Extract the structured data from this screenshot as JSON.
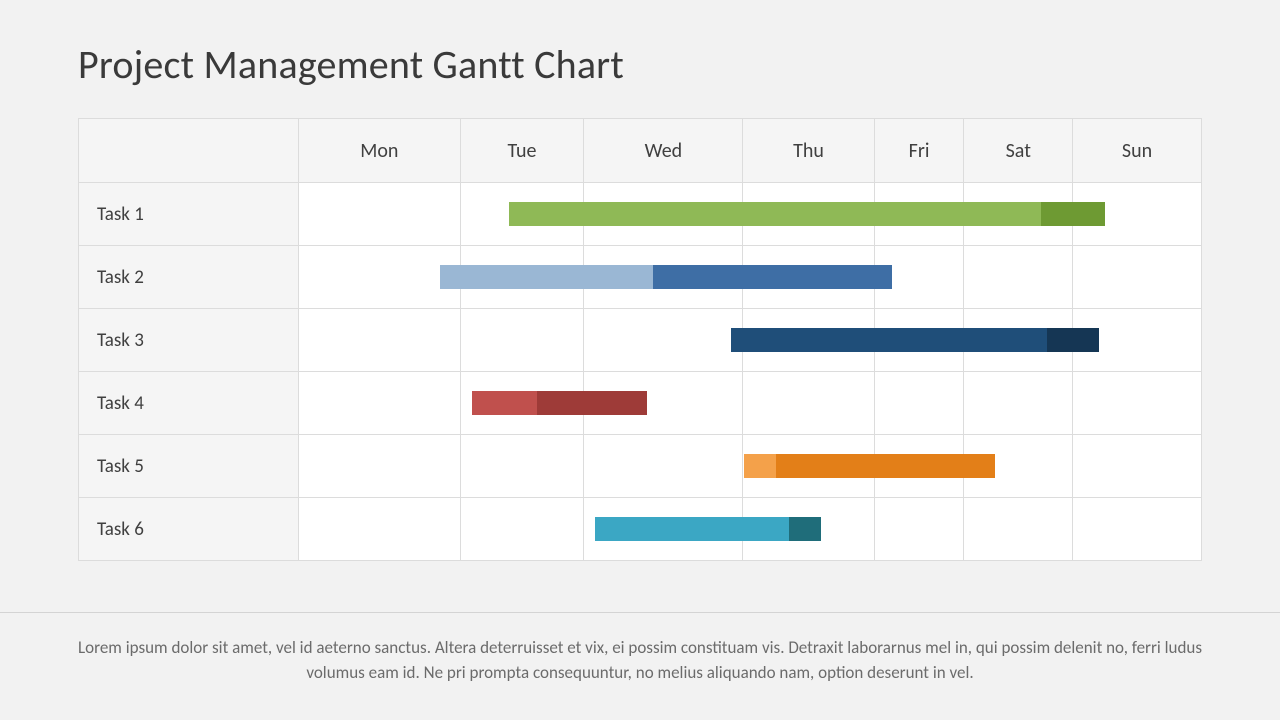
{
  "title": "Project Management Gantt Chart",
  "days": [
    "Mon",
    "Tue",
    "Wed",
    "Thu",
    "Fri",
    "Sat",
    "Sun"
  ],
  "tasks": [
    {
      "name": "Task 1"
    },
    {
      "name": "Task 2"
    },
    {
      "name": "Task 3"
    },
    {
      "name": "Task 4"
    },
    {
      "name": "Task 5"
    },
    {
      "name": "Task 6"
    }
  ],
  "footer": "Lorem ipsum dolor sit amet, vel id aeterno sanctus. Altera deterruisset et vix, ei possim constituam vis. Detraxit laborarnus mel in, qui possim delenit no, ferri ludus volumus eam id. Ne pri prompta consequuntur, no melius aliquando nam, option deserunt in vel.",
  "chart_data": {
    "type": "bar",
    "title": "Project Management Gantt Chart",
    "categories": [
      "Mon",
      "Tue",
      "Wed",
      "Thu",
      "Fri",
      "Sat",
      "Sun"
    ],
    "xlabel": "",
    "ylabel": "",
    "xlim": [
      0,
      7
    ],
    "series": [
      {
        "name": "Task 1",
        "row": 0,
        "segments": [
          {
            "start": 1.63,
            "end": 5.75,
            "color": "#8fb956"
          },
          {
            "start": 5.75,
            "end": 6.25,
            "color": "#6e9a33"
          }
        ]
      },
      {
        "name": "Task 2",
        "row": 1,
        "segments": [
          {
            "start": 1.1,
            "end": 2.75,
            "color": "#9ab7d4"
          },
          {
            "start": 2.75,
            "end": 4.6,
            "color": "#3e6ea5"
          }
        ]
      },
      {
        "name": "Task 3",
        "row": 2,
        "segments": [
          {
            "start": 3.35,
            "end": 5.8,
            "color": "#1f4e79"
          },
          {
            "start": 5.8,
            "end": 6.2,
            "color": "#153654"
          }
        ]
      },
      {
        "name": "Task 4",
        "row": 3,
        "segments": [
          {
            "start": 1.35,
            "end": 1.85,
            "color": "#c0504d"
          },
          {
            "start": 1.85,
            "end": 2.7,
            "color": "#9e3b38"
          }
        ]
      },
      {
        "name": "Task 5",
        "row": 4,
        "segments": [
          {
            "start": 3.45,
            "end": 3.7,
            "color": "#f4a14a"
          },
          {
            "start": 3.7,
            "end": 5.4,
            "color": "#e37f18"
          }
        ]
      },
      {
        "name": "Task 6",
        "row": 5,
        "segments": [
          {
            "start": 2.3,
            "end": 3.8,
            "color": "#3ba7c4"
          },
          {
            "start": 3.8,
            "end": 4.05,
            "color": "#1f6d7a"
          }
        ]
      }
    ]
  }
}
